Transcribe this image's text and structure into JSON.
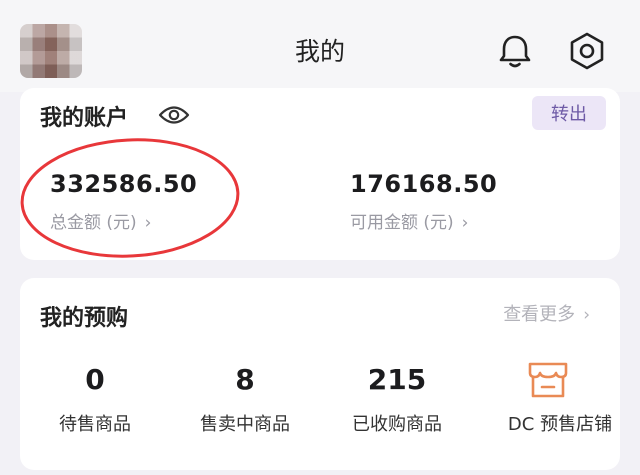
{
  "header": {
    "title": "我的"
  },
  "account": {
    "title": "我的账户",
    "transfer_label": "转出",
    "total_amount": "332586.50",
    "total_label": "总金额 (元)",
    "available_amount": "176168.50",
    "available_label": "可用金额 (元)"
  },
  "presale": {
    "title": "我的预购",
    "more_label": "查看更多",
    "stats": [
      {
        "value": "0",
        "label": "待售商品"
      },
      {
        "value": "8",
        "label": "售卖中商品"
      },
      {
        "value": "215",
        "label": "已收购商品"
      }
    ],
    "store_label": "DC 预售店铺"
  },
  "colors": {
    "accent": "#6e5aa6",
    "accent_bg": "#ece6f7",
    "highlight": "#e8373a",
    "store_icon": "#e98a55"
  },
  "icons": [
    "bell-icon",
    "gear-icon",
    "eye-icon",
    "chevron-right-icon",
    "store-icon"
  ]
}
